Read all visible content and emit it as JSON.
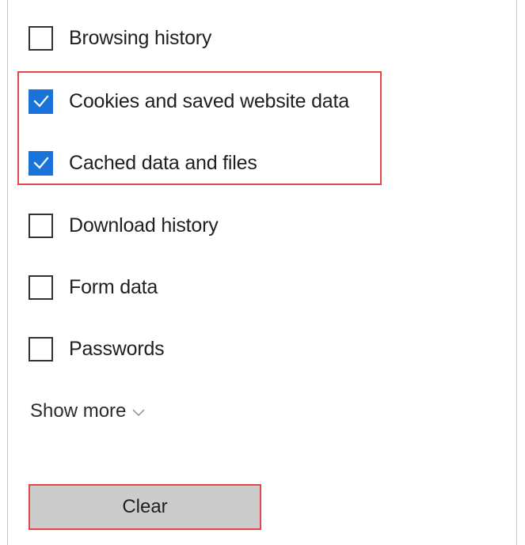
{
  "clear_data": {
    "options": [
      {
        "label": "Browsing history",
        "checked": false
      },
      {
        "label": "Cookies and saved website data",
        "checked": true
      },
      {
        "label": "Cached data and files",
        "checked": true
      },
      {
        "label": "Download history",
        "checked": false
      },
      {
        "label": "Form data",
        "checked": false
      },
      {
        "label": "Passwords",
        "checked": false
      }
    ],
    "show_more_label": "Show more",
    "clear_button_label": "Clear"
  },
  "colors": {
    "checkbox_checked": "#1a73d9",
    "highlight_border": "#e0474c",
    "button_background": "#cccccc"
  },
  "icons": {
    "checkmark": "checkmark-icon",
    "show_more": "chevron-down-icon"
  }
}
